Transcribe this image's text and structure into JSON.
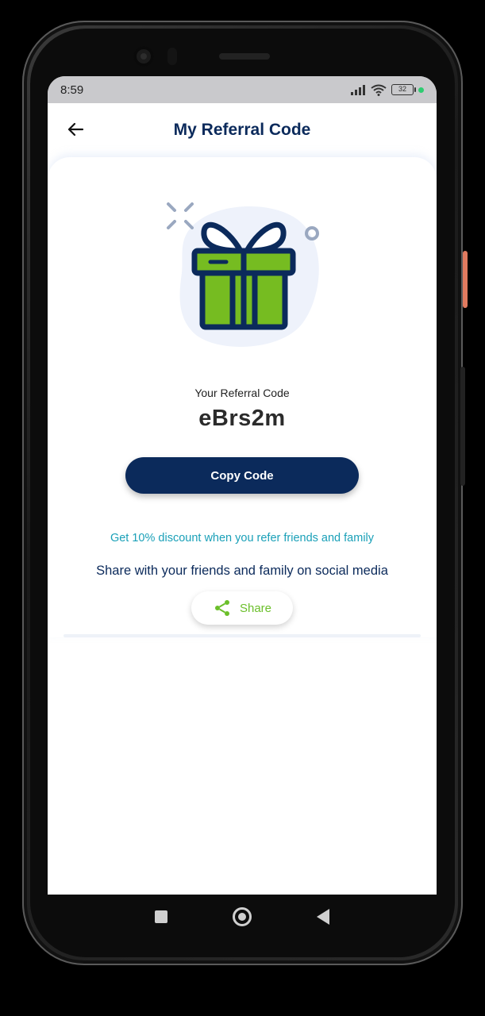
{
  "status": {
    "time": "8:59",
    "battery": "32"
  },
  "header": {
    "title": "My Referral Code"
  },
  "referral": {
    "label": "Your Referral Code",
    "code": "eBrs2m",
    "copy_label": "Copy Code"
  },
  "promo": {
    "discount_text": "Get 10% discount when you refer friends and family",
    "share_text": "Share with your friends and family on social media",
    "share_label": "Share"
  },
  "colors": {
    "primary": "#0b2a5b",
    "accent_green": "#6bbf2a",
    "discount_teal": "#1aa0b8"
  },
  "icons": [
    "back-arrow-icon",
    "gift-icon",
    "share-icon",
    "signal-icon",
    "wifi-icon",
    "battery-icon"
  ]
}
